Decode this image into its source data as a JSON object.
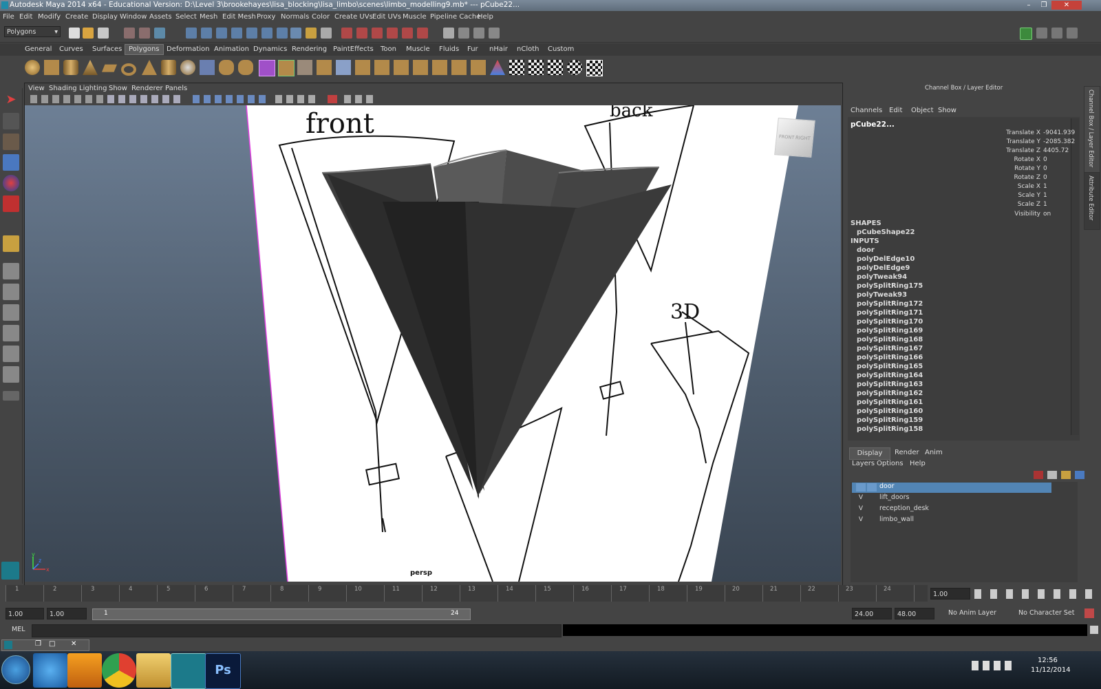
{
  "window": {
    "title": "Autodesk Maya 2014 x64 - Educational Version: D:\\Level 3\\brookehayes\\lisa_blocking\\lisa_limbo\\scenes\\limbo_modelling9.mb*  ---  pCube22...",
    "min": "–",
    "max": "❐",
    "close": "✕"
  },
  "menubar": [
    "File",
    "Edit",
    "Modify",
    "Create",
    "Display",
    "Window",
    "Assets",
    "Select",
    "Mesh",
    "Edit Mesh",
    "Proxy",
    "Normals",
    "Color",
    "Create UVs",
    "Edit UVs",
    "Muscle",
    "Pipeline Cache",
    "Help"
  ],
  "status_line": {
    "menuset": "Polygons"
  },
  "shelf": {
    "tabs": [
      "General",
      "Curves",
      "Surfaces",
      "Polygons",
      "Deformation",
      "Animation",
      "Dynamics",
      "Rendering",
      "PaintEffects",
      "Toon",
      "Muscle",
      "Fluids",
      "Fur",
      "nHair",
      "nCloth",
      "Custom"
    ],
    "active": "Polygons"
  },
  "viewport": {
    "menu": [
      "View",
      "Shading",
      "Lighting",
      "Show",
      "Renderer",
      "Panels"
    ],
    "camera_label": "persp",
    "sketch_labels": [
      "front",
      "back",
      "3D"
    ],
    "viewcube": [
      "FRONT",
      "RIGHT"
    ],
    "axes": [
      "x",
      "y",
      "z"
    ]
  },
  "channel_box": {
    "header": "Channel Box / Layer Editor",
    "menu": [
      "Channels",
      "Edit",
      "Object",
      "Show"
    ],
    "object": "pCube22...",
    "channels": [
      {
        "label": "Translate X",
        "value": "-9041.939"
      },
      {
        "label": "Translate Y",
        "value": "-2085.382"
      },
      {
        "label": "Translate Z",
        "value": "4405.72"
      },
      {
        "label": "Rotate X",
        "value": "0"
      },
      {
        "label": "Rotate Y",
        "value": "0"
      },
      {
        "label": "Rotate Z",
        "value": "0"
      },
      {
        "label": "Scale X",
        "value": "1"
      },
      {
        "label": "Scale Y",
        "value": "1"
      },
      {
        "label": "Scale Z",
        "value": "1"
      },
      {
        "label": "Visibility",
        "value": "on"
      }
    ],
    "shapes_header": "SHAPES",
    "shape": "pCubeShape22",
    "inputs_header": "INPUTS",
    "inputs": [
      "door",
      "polyDelEdge10",
      "polyDelEdge9",
      "polyTweak94",
      "polySplitRing175",
      "polyTweak93",
      "polySplitRing172",
      "polySplitRing171",
      "polySplitRing170",
      "polySplitRing169",
      "polySplitRing168",
      "polySplitRing167",
      "polySplitRing166",
      "polySplitRing165",
      "polySplitRing164",
      "polySplitRing163",
      "polySplitRing162",
      "polySplitRing161",
      "polySplitRing160",
      "polySplitRing159",
      "polySplitRing158"
    ],
    "side_tabs": [
      "Channel Box / Layer Editor",
      "Attribute Editor"
    ]
  },
  "layer_editor": {
    "tabs": [
      "Display",
      "Render",
      "Anim"
    ],
    "menu": [
      "Layers",
      "Options",
      "Help"
    ],
    "layers": [
      {
        "v": "",
        "name": "door",
        "selected": true
      },
      {
        "v": "V",
        "name": "lift_doors",
        "selected": false
      },
      {
        "v": "V",
        "name": "reception_desk",
        "selected": false
      },
      {
        "v": "V",
        "name": "limbo_wall",
        "selected": false
      }
    ]
  },
  "timeline": {
    "ticks": [
      "1",
      "2",
      "3",
      "4",
      "5",
      "6",
      "7",
      "8",
      "9",
      "10",
      "11",
      "12",
      "13",
      "14",
      "15",
      "16",
      "17",
      "18",
      "19",
      "20",
      "21",
      "22",
      "23",
      "24"
    ],
    "current_time": "1.00"
  },
  "range": {
    "start": "1.00",
    "playback_start": "1.00",
    "slider_start": "1",
    "slider_end": "24",
    "playback_end": "24.00",
    "end": "48.00",
    "anim_layer": "No Anim Layer",
    "character_set": "No Character Set"
  },
  "command_line": {
    "label": "MEL"
  },
  "taskbar": {
    "time": "12:56",
    "date": "11/12/2014"
  }
}
